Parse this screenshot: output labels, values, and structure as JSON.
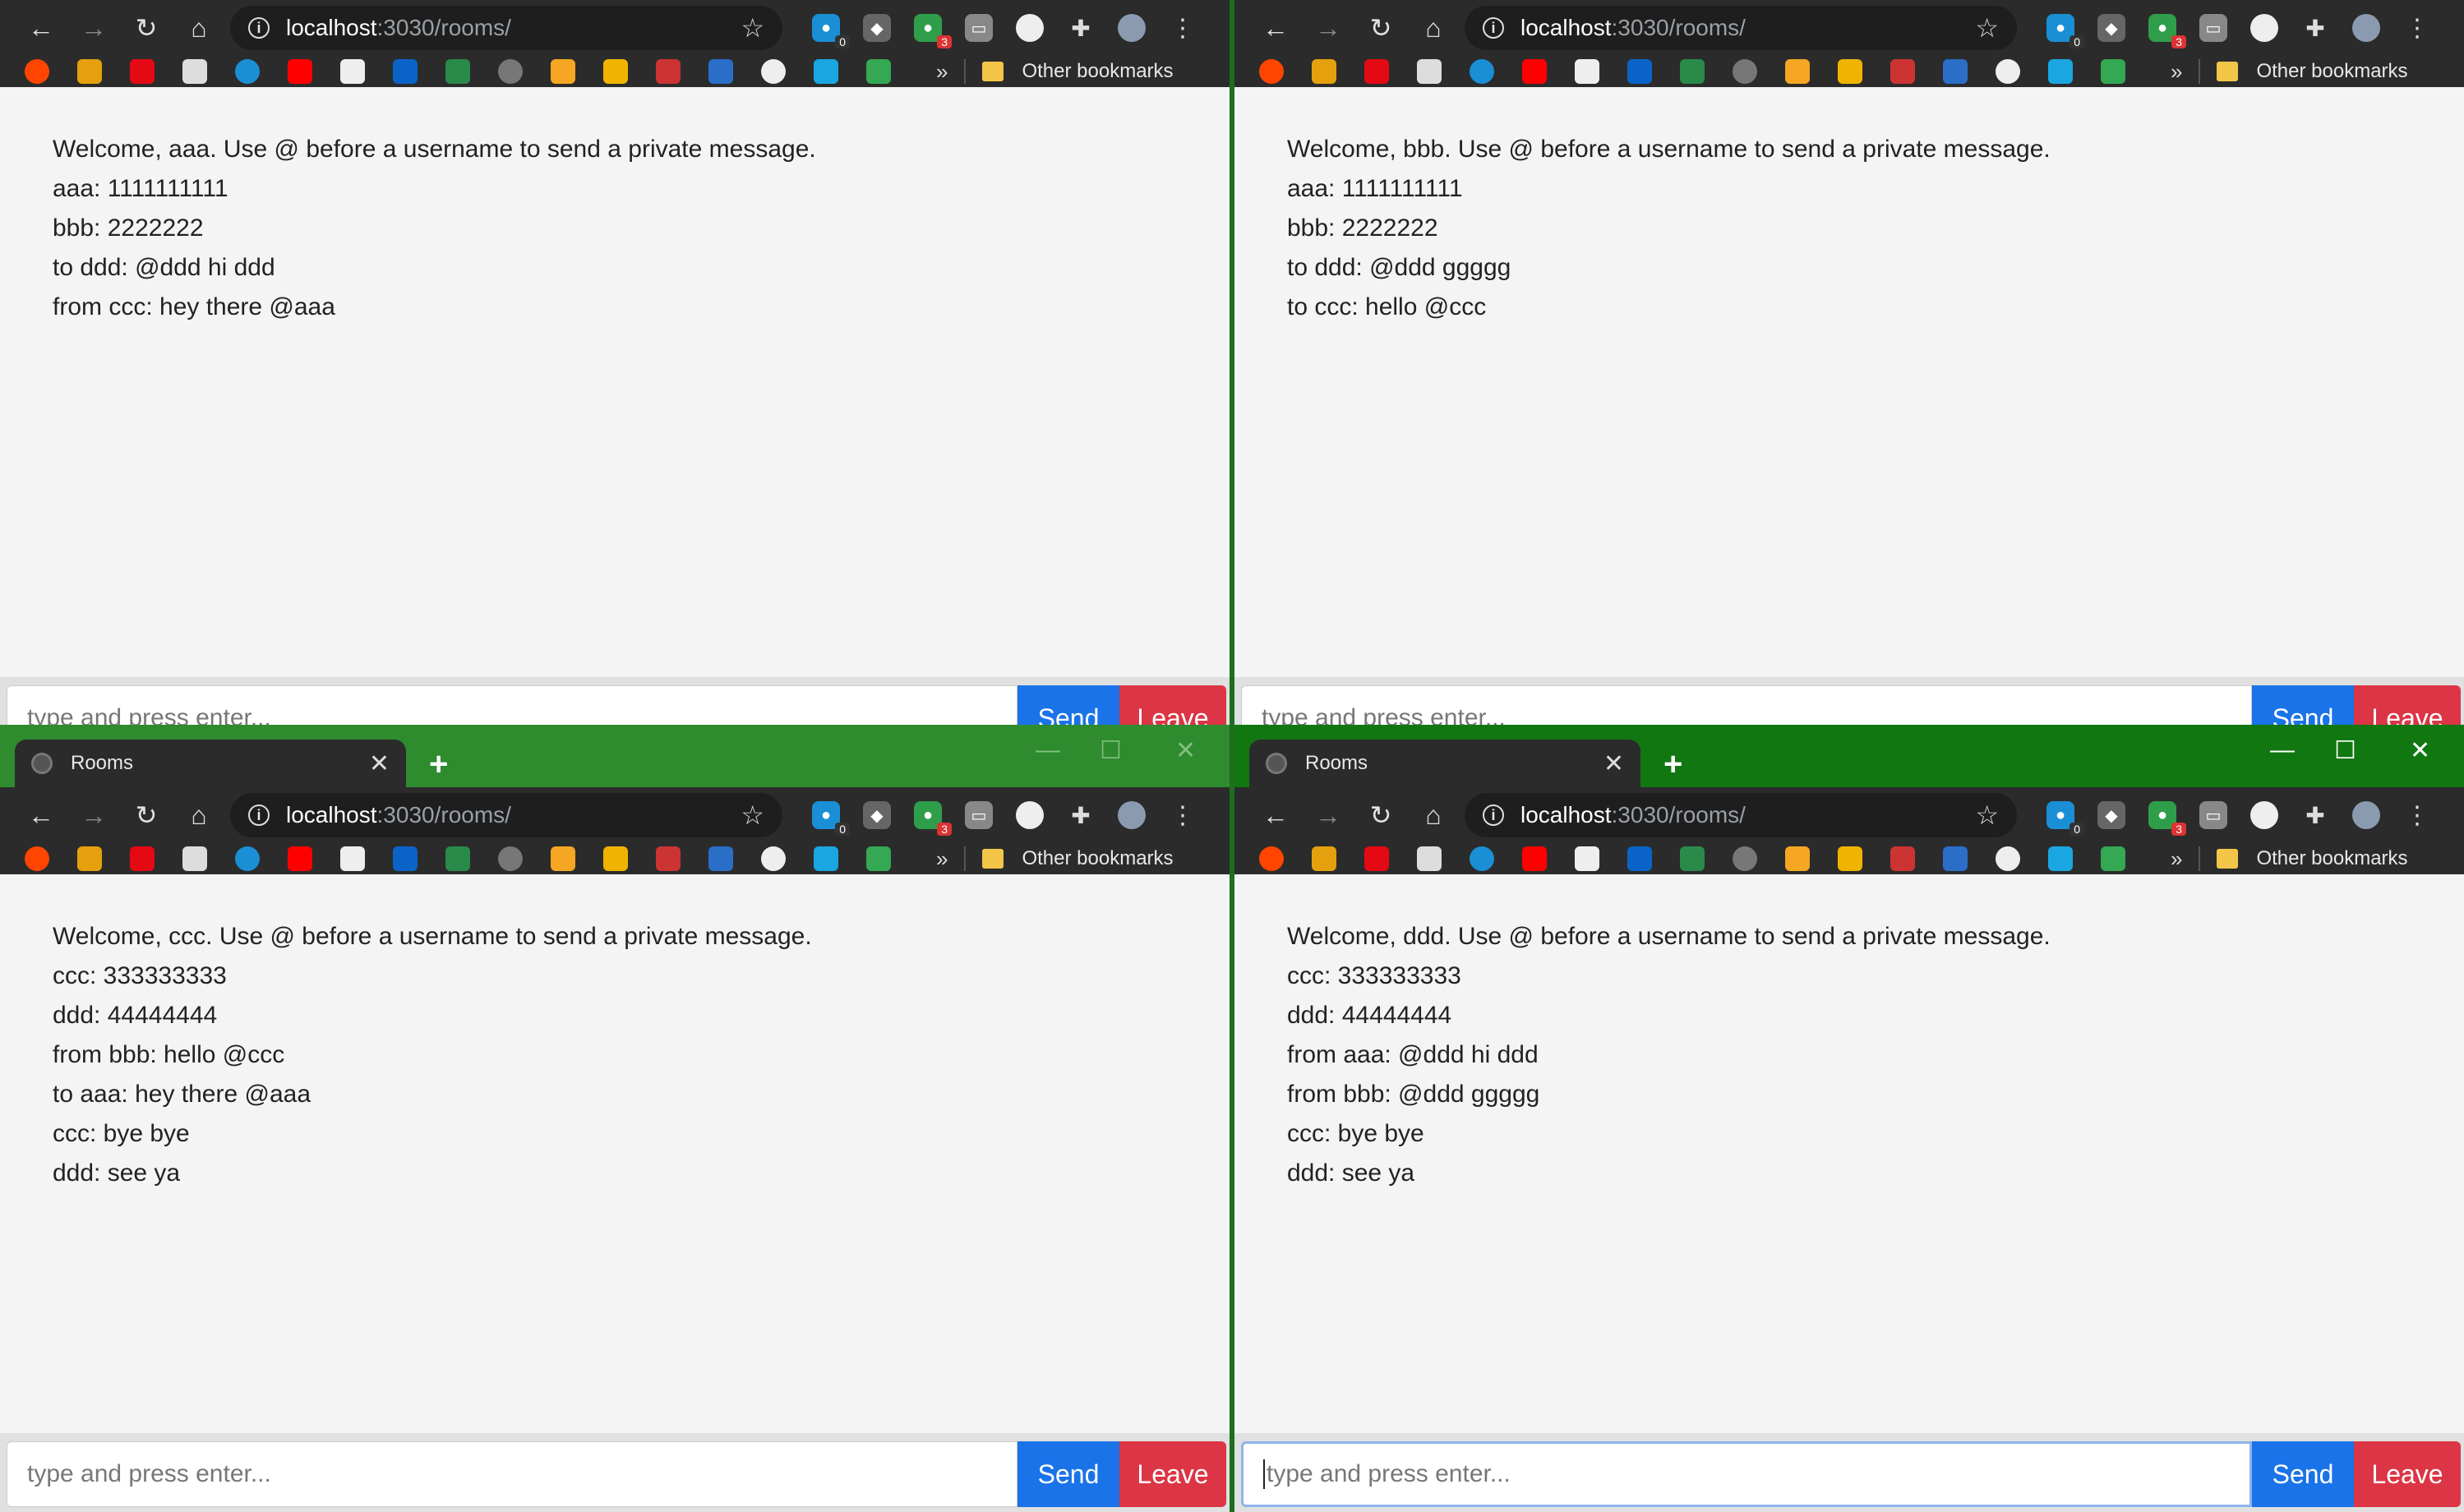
{
  "browser": {
    "url_host": "localhost",
    "url_path": ":3030/rooms/",
    "tab_title": "Rooms",
    "other_bookmarks": "Other bookmarks",
    "ext_badge_1": "0",
    "ext_badge_2": "3"
  },
  "composer": {
    "placeholder": "type and press enter...",
    "send_label": "Send",
    "leave_label": "Leave"
  },
  "windows": [
    {
      "user": "aaa",
      "messages": [
        "Welcome, aaa. Use @ before a username to send a private message.",
        "aaa: 1111111111",
        "bbb: 2222222",
        "to ddd: @ddd hi ddd",
        "from ccc: hey there @aaa"
      ]
    },
    {
      "user": "bbb",
      "messages": [
        "Welcome, bbb. Use @ before a username to send a private message.",
        "aaa: 1111111111",
        "bbb: 2222222",
        "to ddd: @ddd ggggg",
        "to ccc: hello @ccc"
      ]
    },
    {
      "user": "ccc",
      "messages": [
        "Welcome, ccc. Use @ before a username to send a private message.",
        "ccc: 333333333",
        "ddd: 44444444",
        "from bbb: hello @ccc",
        "to aaa: hey there @aaa",
        "ccc: bye bye",
        "ddd: see ya"
      ]
    },
    {
      "user": "ddd",
      "messages": [
        "Welcome, ddd. Use @ before a username to send a private message.",
        "ccc: 333333333",
        "ddd: 44444444",
        "from aaa: @ddd hi ddd",
        "from bbb: @ddd ggggg",
        "ccc: bye bye",
        "ddd: see ya"
      ]
    }
  ],
  "colors": {
    "send": "#1a73e8",
    "leave": "#dc3545",
    "titlebar_active": "#117711",
    "titlebar_inactive": "#2e8b2e"
  }
}
